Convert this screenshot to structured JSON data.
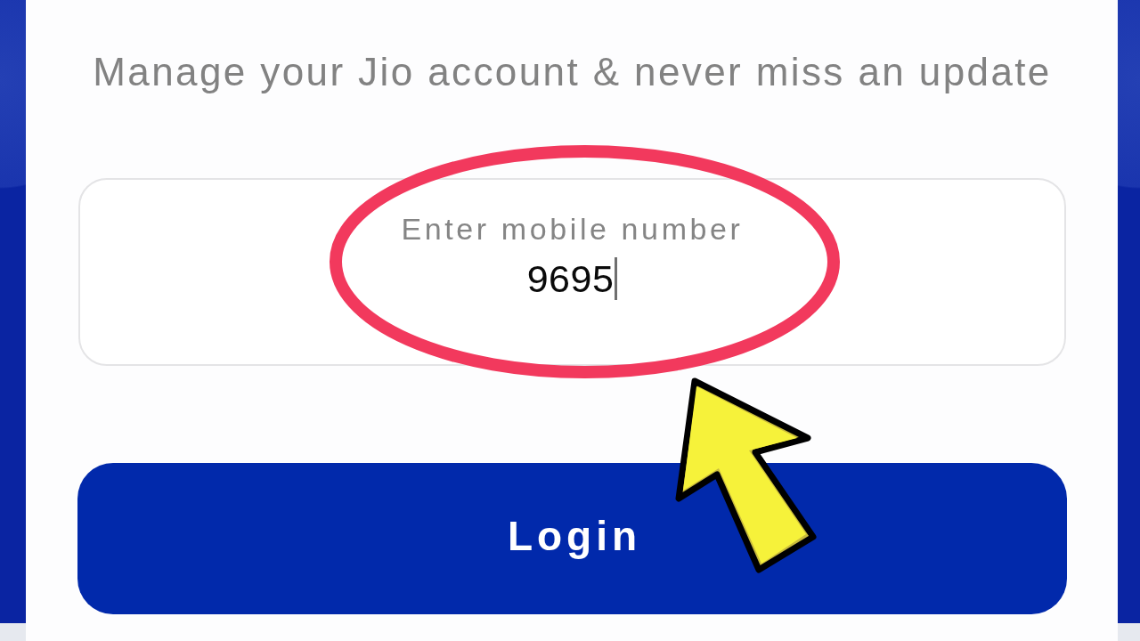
{
  "subtitle": "Manage your Jio account & never miss an update",
  "mobile_field": {
    "label": "Enter mobile number",
    "value": "9695",
    "focused": true
  },
  "login_button": {
    "label": "Login"
  }
}
